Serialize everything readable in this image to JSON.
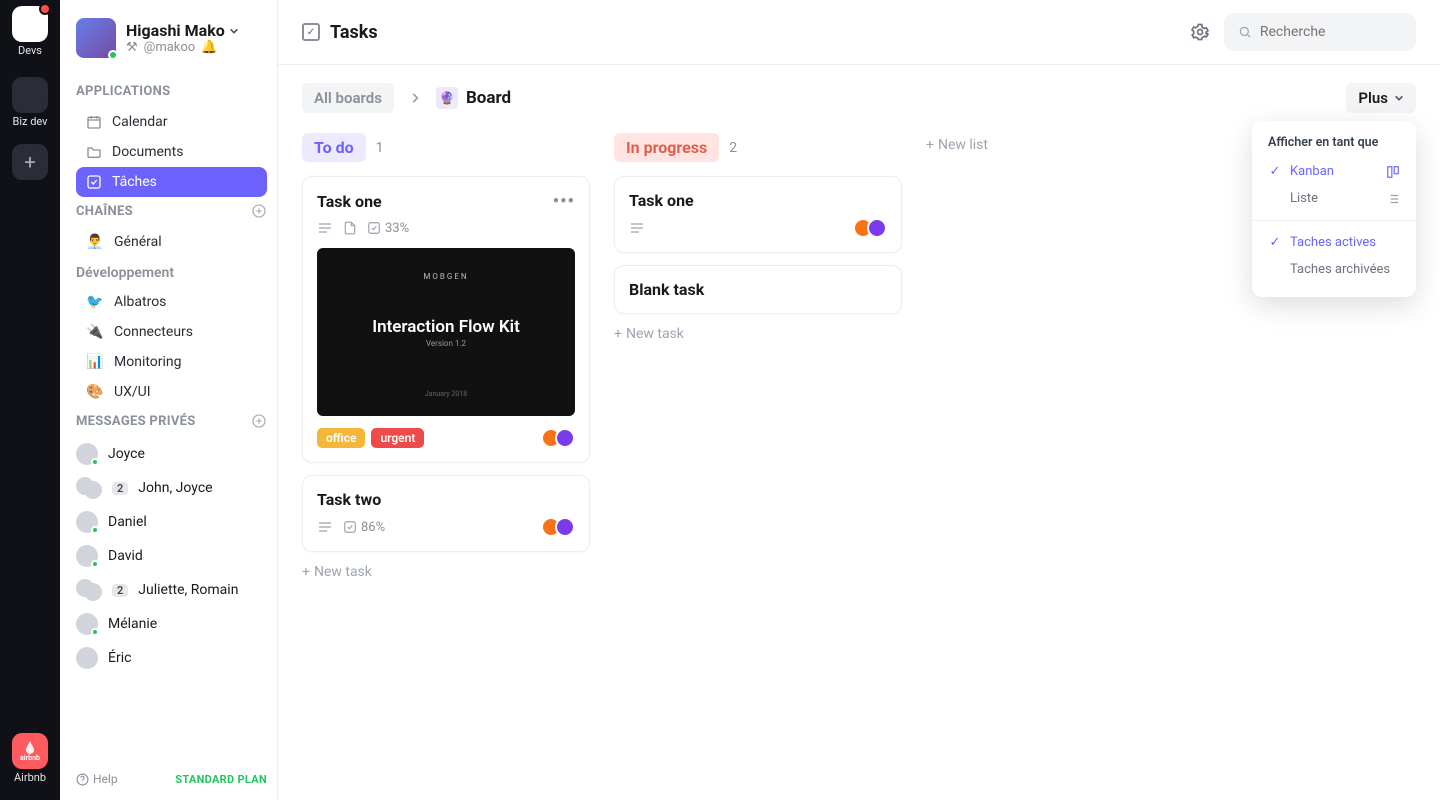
{
  "rail": {
    "items": [
      {
        "label": "Devs",
        "active": true,
        "notif": true
      },
      {
        "label": "Biz dev",
        "active": false
      },
      {
        "label": "Airbnb",
        "active": false,
        "airbnb": true
      }
    ]
  },
  "user": {
    "name": "Higashi Mako",
    "handle": "@makoo"
  },
  "sections": {
    "applications": "APPLICATIONS",
    "channels": "CHAÎNES",
    "dev": "Développement",
    "dms": "MESSAGES PRIVÉS"
  },
  "apps": [
    {
      "label": "Calendar"
    },
    {
      "label": "Documents"
    },
    {
      "label": "Tâches",
      "active": true
    }
  ],
  "channels": [
    {
      "emoji": "👨‍💼",
      "label": "Général"
    }
  ],
  "dev_channels": [
    {
      "emoji": "🐦",
      "label": "Albatros"
    },
    {
      "emoji": "🔌",
      "label": "Connecteurs"
    },
    {
      "emoji": "📊",
      "label": "Monitoring"
    },
    {
      "emoji": "🎨",
      "label": "UX/UI"
    }
  ],
  "dms": [
    {
      "label": "Joyce"
    },
    {
      "label": "John, Joyce",
      "count": 2,
      "pair": true
    },
    {
      "label": "Daniel"
    },
    {
      "label": "David"
    },
    {
      "label": "Juliette, Romain",
      "count": 2,
      "pair": true
    },
    {
      "label": "Mélanie"
    },
    {
      "label": "Éric"
    }
  ],
  "footer": {
    "help": "Help",
    "plan": "STANDARD PLAN"
  },
  "topbar": {
    "title": "Tasks",
    "search_placeholder": "Recherche"
  },
  "breadcrumb": {
    "all": "All boards",
    "board": "Board"
  },
  "plus_btn": "Plus",
  "dropdown": {
    "title": "Afficher en tant que",
    "opts": [
      {
        "label": "Kanban",
        "selected": true,
        "icon": "kanban"
      },
      {
        "label": "Liste",
        "selected": false,
        "icon": "list"
      }
    ],
    "filters": [
      {
        "label": "Taches actives",
        "selected": true
      },
      {
        "label": "Taches archivées",
        "selected": false
      }
    ]
  },
  "columns": [
    {
      "name": "To do",
      "kind": "todo",
      "count": 1,
      "cards": [
        {
          "title": "Task one",
          "desc": true,
          "file": true,
          "checklist": "33%",
          "thumb": {
            "brand": "MOBGEN",
            "line1": "Interaction Flow Kit",
            "line2": "Version 1.2",
            "line3": "January 2018"
          },
          "tags": [
            {
              "t": "office",
              "c": "office"
            },
            {
              "t": "urgent",
              "c": "urgent"
            }
          ],
          "more": true,
          "avatars": 2
        },
        {
          "title": "Task two",
          "desc": true,
          "checklist": "86%",
          "avatars": 2
        }
      ]
    },
    {
      "name": "In progress",
      "kind": "prog",
      "count": 2,
      "cards": [
        {
          "title": "Task one",
          "desc": true,
          "avatars": 2
        },
        {
          "title": "Blank task"
        }
      ]
    }
  ],
  "labels": {
    "new_list": "New list",
    "new_task": "New task"
  }
}
